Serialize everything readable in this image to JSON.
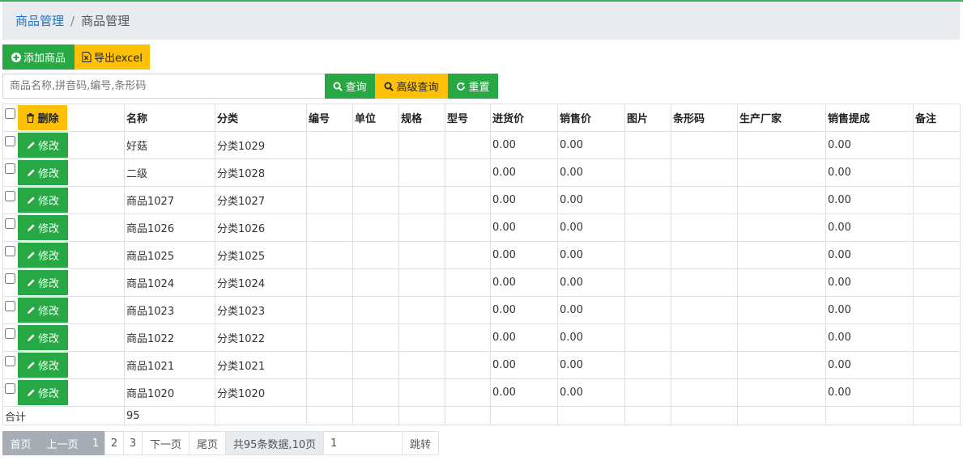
{
  "breadcrumb": {
    "link": "商品管理",
    "separator": "/",
    "current": "商品管理"
  },
  "toolbar": {
    "add_label": "添加商品",
    "export_label": "导出excel"
  },
  "search": {
    "placeholder": "商品名称,拼音码,编号,条形码",
    "value": "",
    "query_label": "查询",
    "advanced_label": "高级查询",
    "reset_label": "重置"
  },
  "table": {
    "delete_label": "删除",
    "edit_label": "修改",
    "headers": [
      "名称",
      "分类",
      "编号",
      "单位",
      "规格",
      "型号",
      "进货价",
      "销售价",
      "图片",
      "条形码",
      "生产厂家",
      "销售提成",
      "备注"
    ],
    "rows": [
      {
        "name": "好菇",
        "category": "分类1029",
        "code": "",
        "unit": "",
        "spec": "",
        "model": "",
        "purchase_price": "0.00",
        "sale_price": "0.00",
        "image": "",
        "barcode": "",
        "manufacturer": "",
        "commission": "0.00",
        "remark": ""
      },
      {
        "name": "二级",
        "category": "分类1028",
        "code": "",
        "unit": "",
        "spec": "",
        "model": "",
        "purchase_price": "0.00",
        "sale_price": "0.00",
        "image": "",
        "barcode": "",
        "manufacturer": "",
        "commission": "0.00",
        "remark": ""
      },
      {
        "name": "商品1027",
        "category": "分类1027",
        "code": "",
        "unit": "",
        "spec": "",
        "model": "",
        "purchase_price": "0.00",
        "sale_price": "0.00",
        "image": "",
        "barcode": "",
        "manufacturer": "",
        "commission": "0.00",
        "remark": ""
      },
      {
        "name": "商品1026",
        "category": "分类1026",
        "code": "",
        "unit": "",
        "spec": "",
        "model": "",
        "purchase_price": "0.00",
        "sale_price": "0.00",
        "image": "",
        "barcode": "",
        "manufacturer": "",
        "commission": "0.00",
        "remark": ""
      },
      {
        "name": "商品1025",
        "category": "分类1025",
        "code": "",
        "unit": "",
        "spec": "",
        "model": "",
        "purchase_price": "0.00",
        "sale_price": "0.00",
        "image": "",
        "barcode": "",
        "manufacturer": "",
        "commission": "0.00",
        "remark": ""
      },
      {
        "name": "商品1024",
        "category": "分类1024",
        "code": "",
        "unit": "",
        "spec": "",
        "model": "",
        "purchase_price": "0.00",
        "sale_price": "0.00",
        "image": "",
        "barcode": "",
        "manufacturer": "",
        "commission": "0.00",
        "remark": ""
      },
      {
        "name": "商品1023",
        "category": "分类1023",
        "code": "",
        "unit": "",
        "spec": "",
        "model": "",
        "purchase_price": "0.00",
        "sale_price": "0.00",
        "image": "",
        "barcode": "",
        "manufacturer": "",
        "commission": "0.00",
        "remark": ""
      },
      {
        "name": "商品1022",
        "category": "分类1022",
        "code": "",
        "unit": "",
        "spec": "",
        "model": "",
        "purchase_price": "0.00",
        "sale_price": "0.00",
        "image": "",
        "barcode": "",
        "manufacturer": "",
        "commission": "0.00",
        "remark": ""
      },
      {
        "name": "商品1021",
        "category": "分类1021",
        "code": "",
        "unit": "",
        "spec": "",
        "model": "",
        "purchase_price": "0.00",
        "sale_price": "0.00",
        "image": "",
        "barcode": "",
        "manufacturer": "",
        "commission": "0.00",
        "remark": ""
      },
      {
        "name": "商品1020",
        "category": "分类1020",
        "code": "",
        "unit": "",
        "spec": "",
        "model": "",
        "purchase_price": "0.00",
        "sale_price": "0.00",
        "image": "",
        "barcode": "",
        "manufacturer": "",
        "commission": "0.00",
        "remark": ""
      }
    ],
    "total_label": "合计",
    "total_value": "95"
  },
  "pager": {
    "first": "首页",
    "prev": "上一页",
    "pages": [
      "1",
      "2",
      "3"
    ],
    "current_page": "1",
    "next": "下一页",
    "last": "尾页",
    "info": "共95条数据,10页",
    "jump_value": "1",
    "jump_label": "跳转"
  },
  "colors": {
    "green": "#28a745",
    "yellow": "#ffc107",
    "link": "#1a73c9",
    "topline": "#3cae5e"
  },
  "icons": {
    "add": "plus-circle-icon",
    "export": "excel-file-icon",
    "search": "search-icon",
    "advanced": "search-icon",
    "reset": "refresh-icon",
    "delete": "trash-icon",
    "edit": "pencil-icon"
  }
}
